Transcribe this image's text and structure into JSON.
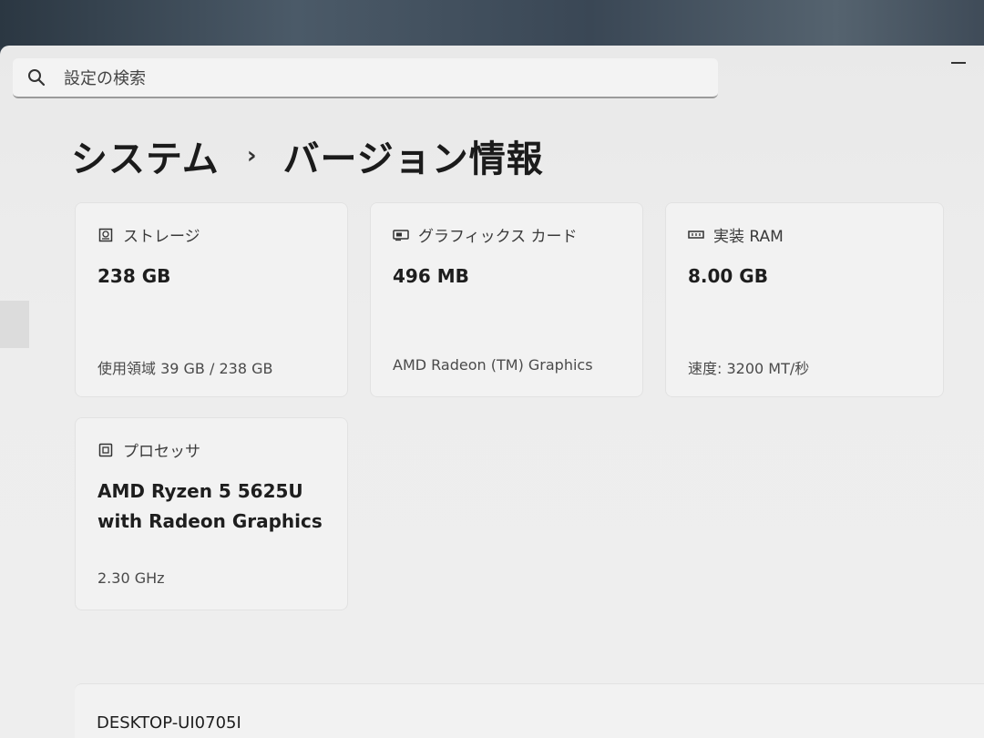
{
  "search": {
    "placeholder": "設定の検索"
  },
  "breadcrumb": {
    "parent": "システム",
    "separator": "›",
    "current": "バージョン情報"
  },
  "specs": {
    "storage": {
      "icon": "storage-icon",
      "label": "ストレージ",
      "value": "238 GB",
      "detail": "使用領域 39 GB / 238 GB"
    },
    "graphics": {
      "icon": "graphics-card-icon",
      "label": "グラフィックス カード",
      "value": "496 MB",
      "detail": "AMD Radeon (TM) Graphics"
    },
    "ram": {
      "icon": "memory-icon",
      "label": "実装 RAM",
      "value": "8.00 GB",
      "detail": "速度: 3200 MT/秒"
    },
    "processor": {
      "icon": "processor-icon",
      "label": "プロセッサ",
      "value": "AMD Ryzen 5 5625U\nwith Radeon Graphics",
      "detail": "2.30 GHz"
    }
  },
  "device": {
    "name": "DESKTOP-UI0705I"
  }
}
